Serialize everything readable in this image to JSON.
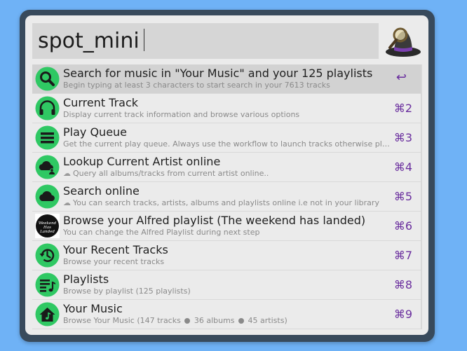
{
  "colors": {
    "background": "#6fb2f6",
    "window_frame": "#384a5c",
    "icon_green": "#2fc863",
    "shortcut_purple": "#6a2e9e"
  },
  "search": {
    "query": "spot_mini"
  },
  "results": [
    {
      "title": "Search for music in \"Your Music\" and your 125 playlists",
      "subtitle": "Begin typing at least 3 characters to start search in your 7613 tracks",
      "shortcut": "↩",
      "icon": "search-icon",
      "selected": true
    },
    {
      "title": "Current Track",
      "subtitle": "Display current track information and browse various options",
      "shortcut": "⌘2",
      "icon": "headphones-icon"
    },
    {
      "title": "Play Queue",
      "subtitle": "Get the current play queue. Always use the workflow to launch tracks otherwise play queue will be empty",
      "shortcut": "⌘3",
      "icon": "queue-list-icon"
    },
    {
      "title": "Lookup Current Artist online",
      "subtitle": "Query all albums/tracks from current artist online..",
      "subtitle_icon": "☁",
      "shortcut": "⌘4",
      "icon": "cloud-person-icon"
    },
    {
      "title": "Search online",
      "subtitle": "You can search tracks, artists, albums and playlists online i.e not in your library",
      "subtitle_icon": "☁",
      "shortcut": "⌘5",
      "icon": "cloud-icon"
    },
    {
      "title": "Browse your Alfred playlist (The weekend has landed)",
      "subtitle": "You can change the Alfred Playlist during next step",
      "shortcut": "⌘6",
      "icon": "playlist-cover-icon",
      "cover_text": "Weekend Has Landed"
    },
    {
      "title": "Your Recent Tracks",
      "subtitle": "Browse your recent tracks",
      "shortcut": "⌘7",
      "icon": "history-icon"
    },
    {
      "title": "Playlists",
      "subtitle": "Browse by playlist (125 playlists)",
      "shortcut": "⌘8",
      "icon": "playlist-icon"
    },
    {
      "title": "Your Music",
      "subtitle_parts": [
        "Browse Your Music (147 tracks",
        "36  albums",
        "45 artists)"
      ],
      "shortcut": "⌘9",
      "icon": "home-music-icon"
    }
  ]
}
